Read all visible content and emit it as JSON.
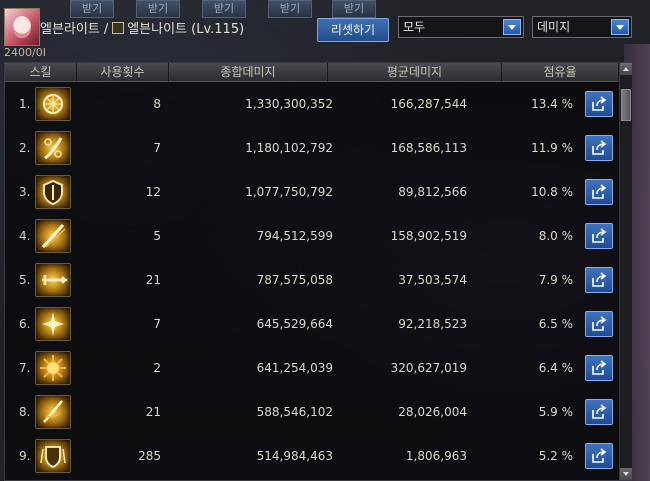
{
  "background": {
    "tabs": [
      "받기",
      "받기",
      "받기",
      "받기",
      "받기"
    ]
  },
  "header": {
    "hp_text": "2400/0I",
    "name_prefix": "엘븐라이트",
    "slash": "/",
    "class_name": "엘븐나이트",
    "level": "(Lv.115)",
    "reset_label": "리셋하기",
    "filter_all": "모두",
    "filter_metric": "데미지"
  },
  "table": {
    "columns": [
      "스킬",
      "사용횟수",
      "종합데미지",
      "평균데미지",
      "점유율"
    ],
    "rows": [
      {
        "idx": "1.",
        "icon": "wheel-skill-icon",
        "count": "8",
        "total": "1,330,300,352",
        "avg": "166,287,544",
        "share": "13.4 %"
      },
      {
        "idx": "2.",
        "icon": "chain-skill-icon",
        "count": "7",
        "total": "1,180,102,792",
        "avg": "168,586,113",
        "share": "11.9 %"
      },
      {
        "idx": "3.",
        "icon": "shield-skill-icon",
        "count": "12",
        "total": "1,077,750,792",
        "avg": "89,812,566",
        "share": "10.8 %"
      },
      {
        "idx": "4.",
        "icon": "slash-skill-icon",
        "count": "5",
        "total": "794,512,599",
        "avg": "158,902,519",
        "share": "8.0 %"
      },
      {
        "idx": "5.",
        "icon": "sword-skill-icon",
        "count": "21",
        "total": "787,575,058",
        "avg": "37,503,574",
        "share": "7.9 %"
      },
      {
        "idx": "6.",
        "icon": "sparkle-skill-icon",
        "count": "7",
        "total": "645,529,664",
        "avg": "92,218,523",
        "share": "6.5 %"
      },
      {
        "idx": "7.",
        "icon": "burst-skill-icon",
        "count": "2",
        "total": "641,254,039",
        "avg": "320,627,019",
        "share": "6.4 %"
      },
      {
        "idx": "8.",
        "icon": "blade-skill-icon",
        "count": "21",
        "total": "588,546,102",
        "avg": "28,026,004",
        "share": "5.9 %"
      },
      {
        "idx": "9.",
        "icon": "guard-skill-icon",
        "count": "285",
        "total": "514,984,463",
        "avg": "1,806,963",
        "share": "5.2 %"
      }
    ]
  }
}
